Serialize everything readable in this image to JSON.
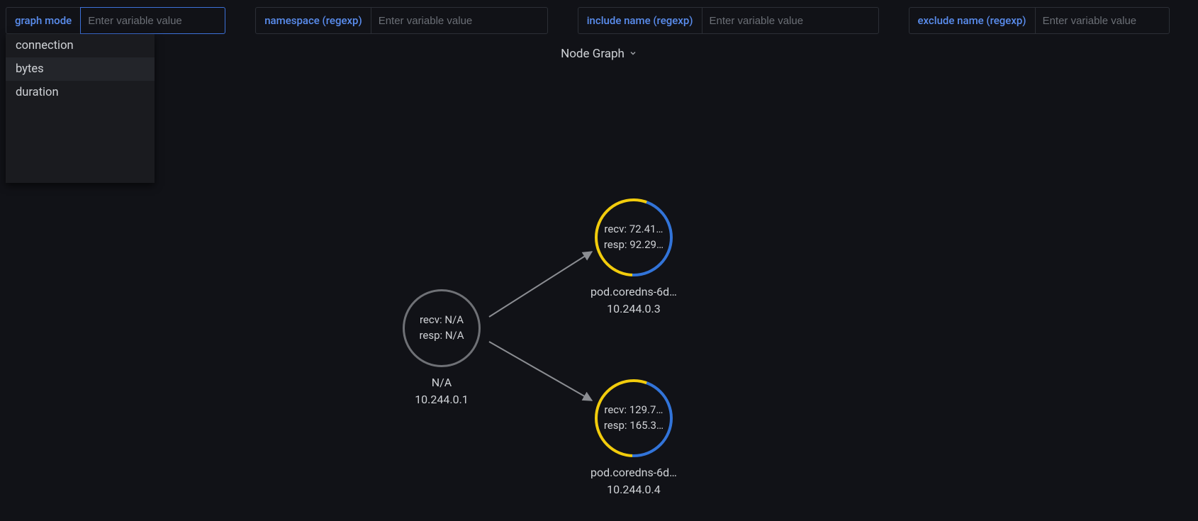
{
  "variables": [
    {
      "label": "graph mode",
      "placeholder": "Enter variable value",
      "value": "",
      "focused": true,
      "options": [
        "connection",
        "bytes",
        "duration"
      ],
      "selected_index": 1
    },
    {
      "label": "namespace (regexp)",
      "placeholder": "Enter variable value",
      "value": ""
    },
    {
      "label": "include name (regexp)",
      "placeholder": "Enter variable value",
      "value": ""
    },
    {
      "label": "exclude name (regexp)",
      "placeholder": "Enter variable value",
      "value": ""
    }
  ],
  "panel": {
    "title": "Node Graph"
  },
  "graph": {
    "nodes": [
      {
        "id": "n1",
        "recv": "N/A",
        "resp": "N/A",
        "title": "N/A",
        "subtitle": "10.244.0.1",
        "style": "gray",
        "yellow_frac": 0,
        "blue_frac": 0
      },
      {
        "id": "n2",
        "recv": "72.41…",
        "resp": "92.29…",
        "title": "pod.coredns-6d…",
        "subtitle": "10.244.0.3",
        "style": "ring",
        "yellow_frac": 0.55,
        "blue_frac": 0.45
      },
      {
        "id": "n3",
        "recv": "129.7…",
        "resp": "165.3…",
        "title": "pod.coredns-6d…",
        "subtitle": "10.244.0.4",
        "style": "ring",
        "yellow_frac": 0.55,
        "blue_frac": 0.45
      }
    ],
    "edges": [
      {
        "from": "n1",
        "to": "n2"
      },
      {
        "from": "n1",
        "to": "n3"
      }
    ]
  },
  "colors": {
    "accent": "#5a8dee",
    "yellow": "#f2cc0c",
    "blue": "#3274d9",
    "gray": "#6f7176"
  }
}
